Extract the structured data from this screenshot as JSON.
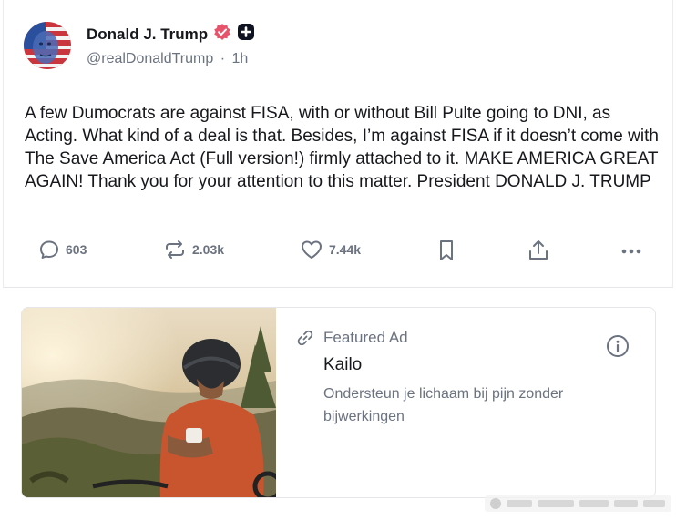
{
  "post": {
    "author_name": "Donald J. Trump",
    "handle": "@realDonaldTrump",
    "separator": "·",
    "time": "1h",
    "text": "A few Dumocrats are against FISA, with or without Bill Pulte going to DNI, as Acting. What kind of a deal is that. Besides, I’m against FISA if it doesn’t come with The Save America Act (Full version!) firmly attached to it. MAKE AMERICA GREAT AGAIN! Thank you for your attention to this matter. President DONALD J. TRUMP",
    "actions": {
      "replies": "603",
      "retruths": "2.03k",
      "likes": "7.44k"
    }
  },
  "icons": [
    "verified-badge-icon",
    "plus-badge-icon",
    "reply-icon",
    "retruth-icon",
    "like-icon",
    "bookmark-icon",
    "share-icon",
    "more-icon",
    "link-icon",
    "info-icon"
  ],
  "colors": {
    "verified_badge": "#e7536a",
    "text_primary": "#16181c",
    "text_secondary": "#6b7280",
    "border": "#e6e6ea"
  },
  "ad": {
    "label": "Featured Ad",
    "title": "Kailo",
    "description": "Ondersteun je lichaam bij pijn zonder bijwerkingen"
  }
}
